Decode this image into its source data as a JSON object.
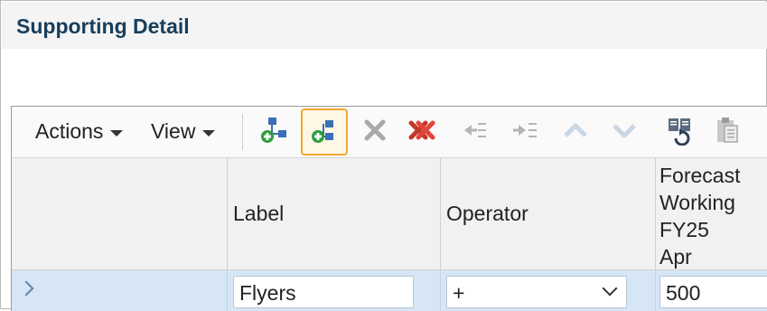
{
  "title": "Supporting Detail",
  "toolbar": {
    "actions_label": "Actions",
    "view_label": "View",
    "buttons": [
      {
        "name": "add-child-button",
        "icon": "add-child-icon"
      },
      {
        "name": "add-sibling-button",
        "icon": "add-sibling-icon",
        "state": "focused"
      },
      {
        "name": "delete-button",
        "icon": "delete-icon",
        "state": "disabled"
      },
      {
        "name": "delete-all-button",
        "icon": "delete-all-icon"
      },
      {
        "name": "outdent-button",
        "icon": "outdent-icon",
        "state": "disabled"
      },
      {
        "name": "indent-button",
        "icon": "indent-icon",
        "state": "disabled"
      },
      {
        "name": "move-up-button",
        "icon": "move-up-icon",
        "state": "disabled"
      },
      {
        "name": "move-down-button",
        "icon": "move-down-icon",
        "state": "disabled"
      },
      {
        "name": "duplicate-button",
        "icon": "duplicate-icon"
      },
      {
        "name": "paste-button",
        "icon": "paste-icon",
        "state": "disabled"
      }
    ]
  },
  "grid": {
    "headers": {
      "label": "Label",
      "operator": "Operator",
      "period": [
        "Forecast",
        "Working",
        "FY25",
        "Apr"
      ]
    },
    "rows": [
      {
        "label": "Flyers",
        "operator": "+",
        "value": "500"
      }
    ]
  },
  "colors": {
    "title": "#173e5c",
    "row_selected": "#d6e6f6",
    "focus_ring": "#f0a830"
  }
}
